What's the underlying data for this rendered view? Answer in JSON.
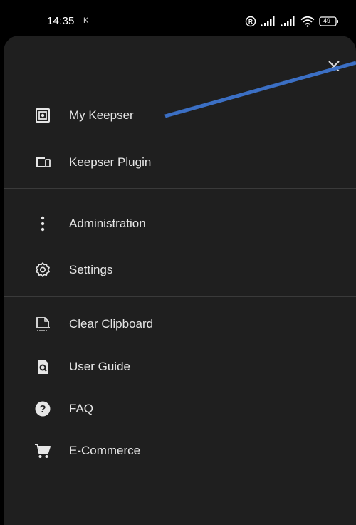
{
  "status_bar": {
    "time": "14:35",
    "indicator": "K",
    "battery": "49"
  },
  "drawer": {
    "close_icon": "close-icon",
    "sections": [
      {
        "items": [
          {
            "label": "My Keepser",
            "icon": "safe-icon"
          },
          {
            "label": "Keepser Plugin",
            "icon": "devices-icon"
          }
        ]
      },
      {
        "items": [
          {
            "label": "Administration",
            "icon": "more-vertical-icon"
          },
          {
            "label": "Settings",
            "icon": "gear-icon"
          }
        ]
      },
      {
        "items": [
          {
            "label": "Clear Clipboard",
            "icon": "clipboard-clear-icon"
          },
          {
            "label": "User Guide",
            "icon": "document-search-icon"
          },
          {
            "label": "FAQ",
            "icon": "help-circle-icon"
          },
          {
            "label": "E-Commerce",
            "icon": "cart-icon"
          }
        ]
      }
    ]
  },
  "colors": {
    "background": "#000000",
    "drawer": "#1f1f1f",
    "text": "#e6e6e6",
    "divider": "#3a3a3a",
    "annotation_arrow": "#3b6fc4"
  }
}
